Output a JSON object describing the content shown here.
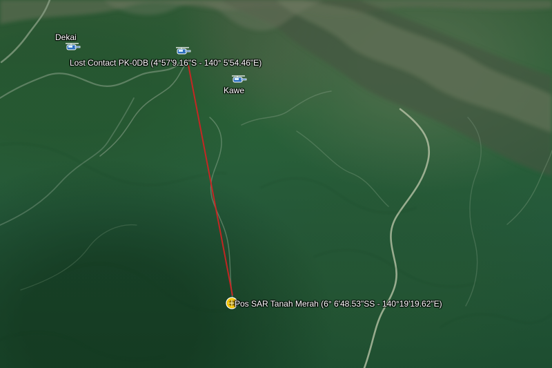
{
  "places": [
    {
      "key": "dekai",
      "label": "Dekai",
      "icon": "helicopter-icon"
    },
    {
      "key": "lost_contact",
      "label": "Lost Contact PK-0DB (4°57'9.16\"S - 140° 5'54.46\"E)",
      "icon": "helicopter-icon"
    },
    {
      "key": "kawe",
      "label": "Kawe",
      "icon": "helicopter-icon"
    },
    {
      "key": "sar_post",
      "label": "Pos SAR Tanah Merah (6° 6'48.53\"SS - 140°19'19.62\"E)",
      "icon": "sar-post-icon"
    }
  ],
  "route": {
    "from": "Lost Contact PK-0DB",
    "to": "Pos SAR Tanah Merah",
    "color": "#d62222"
  }
}
